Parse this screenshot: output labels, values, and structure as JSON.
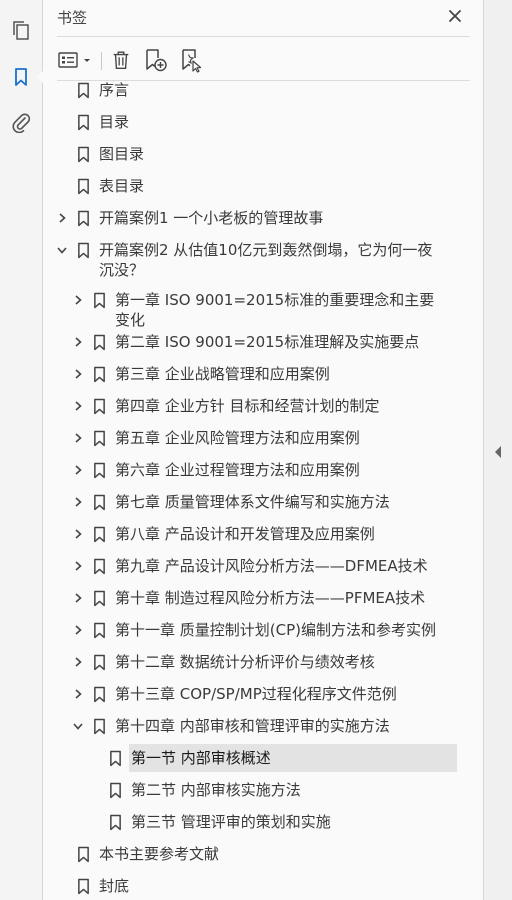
{
  "panel": {
    "title": "书签"
  },
  "icons": {
    "rail": [
      "pages-icon",
      "bookmark-icon",
      "attachment-icon"
    ],
    "toolbar": [
      "options-menu-icon",
      "delete-icon",
      "new-bookmark-icon",
      "find-bookmark-icon"
    ]
  },
  "colors": {
    "selected_row": "#e3e3e3",
    "active_rail": "#1a73c8",
    "scroll_thumb": "#8c8c8c"
  },
  "tree": [
    {
      "label": "序言",
      "level": 0,
      "expand": "none",
      "selected": false
    },
    {
      "label": "目录",
      "level": 0,
      "expand": "none",
      "selected": false
    },
    {
      "label": "图目录",
      "level": 0,
      "expand": "none",
      "selected": false
    },
    {
      "label": "表目录",
      "level": 0,
      "expand": "none",
      "selected": false
    },
    {
      "label": "开篇案例1 一个小老板的管理故事",
      "level": 0,
      "expand": "collapsed",
      "selected": false
    },
    {
      "label": "开篇案例2 从估值10亿元到轰然倒塌，它为何一夜沉没？",
      "level": 0,
      "expand": "expanded",
      "selected": false
    },
    {
      "label": "第一章 ISO 9001=2015标准的重要理念和主要变化",
      "level": 1,
      "expand": "collapsed",
      "selected": false
    },
    {
      "label": "第二章 ISO 9001=2015标准理解及实施要点",
      "level": 1,
      "expand": "collapsed",
      "selected": false
    },
    {
      "label": "第三章 企业战略管理和应用案例",
      "level": 1,
      "expand": "collapsed",
      "selected": false
    },
    {
      "label": "第四章 企业方针 目标和经营计划的制定",
      "level": 1,
      "expand": "collapsed",
      "selected": false
    },
    {
      "label": "第五章 企业风险管理方法和应用案例",
      "level": 1,
      "expand": "collapsed",
      "selected": false
    },
    {
      "label": "第六章 企业过程管理方法和应用案例",
      "level": 1,
      "expand": "collapsed",
      "selected": false
    },
    {
      "label": "第七章 质量管理体系文件编写和实施方法",
      "level": 1,
      "expand": "collapsed",
      "selected": false
    },
    {
      "label": "第八章 产品设计和开发管理及应用案例",
      "level": 1,
      "expand": "collapsed",
      "selected": false
    },
    {
      "label": "第九章 产品设计风险分析方法——DFMEA技术",
      "level": 1,
      "expand": "collapsed",
      "selected": false
    },
    {
      "label": "第十章 制造过程风险分析方法——PFMEA技术",
      "level": 1,
      "expand": "collapsed",
      "selected": false
    },
    {
      "label": "第十一章 质量控制计划(CP)编制方法和参考实例",
      "level": 1,
      "expand": "collapsed",
      "selected": false
    },
    {
      "label": "第十二章 数据统计分析评价与绩效考核",
      "level": 1,
      "expand": "collapsed",
      "selected": false
    },
    {
      "label": "第十三章 COP/SP/MP过程化程序文件范例",
      "level": 1,
      "expand": "collapsed",
      "selected": false
    },
    {
      "label": "第十四章 内部审核和管理评审的实施方法",
      "level": 1,
      "expand": "expanded",
      "selected": false
    },
    {
      "label": "第一节 内部审核概述",
      "level": 2,
      "expand": "none",
      "selected": true
    },
    {
      "label": "第二节 内部审核实施方法",
      "level": 2,
      "expand": "none",
      "selected": false
    },
    {
      "label": "第三节 管理评审的策划和实施",
      "level": 2,
      "expand": "none",
      "selected": false
    },
    {
      "label": "本书主要参考文献",
      "level": 0,
      "expand": "none",
      "selected": false
    },
    {
      "label": "封底",
      "level": 0,
      "expand": "none",
      "selected": false
    }
  ]
}
